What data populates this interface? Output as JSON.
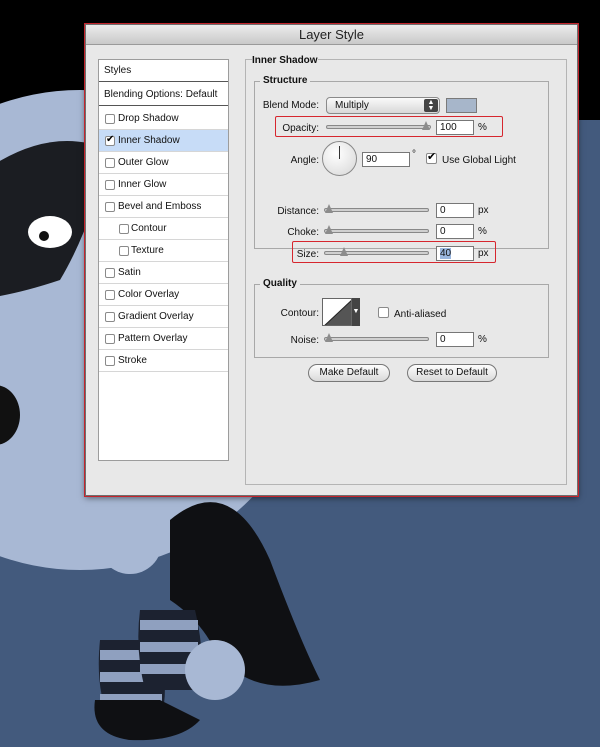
{
  "dialog": {
    "title": "Layer Style"
  },
  "styles_list": {
    "header": "Styles",
    "blending": "Blending Options: Default",
    "items": [
      {
        "label": "Drop Shadow",
        "checked": false,
        "selected": false,
        "indent": false
      },
      {
        "label": "Inner Shadow",
        "checked": true,
        "selected": true,
        "indent": false
      },
      {
        "label": "Outer Glow",
        "checked": false,
        "selected": false,
        "indent": false
      },
      {
        "label": "Inner Glow",
        "checked": false,
        "selected": false,
        "indent": false
      },
      {
        "label": "Bevel and Emboss",
        "checked": false,
        "selected": false,
        "indent": false
      },
      {
        "label": "Contour",
        "checked": false,
        "selected": false,
        "indent": true
      },
      {
        "label": "Texture",
        "checked": false,
        "selected": false,
        "indent": true
      },
      {
        "label": "Satin",
        "checked": false,
        "selected": false,
        "indent": false
      },
      {
        "label": "Color Overlay",
        "checked": false,
        "selected": false,
        "indent": false
      },
      {
        "label": "Gradient Overlay",
        "checked": false,
        "selected": false,
        "indent": false
      },
      {
        "label": "Pattern Overlay",
        "checked": false,
        "selected": false,
        "indent": false
      },
      {
        "label": "Stroke",
        "checked": false,
        "selected": false,
        "indent": false
      }
    ]
  },
  "inner_shadow": {
    "title": "Inner Shadow",
    "structure": {
      "title": "Structure",
      "blend_mode_label": "Blend Mode:",
      "blend_mode_value": "Multiply",
      "shadow_color": "#a7b6ca",
      "opacity_label": "Opacity:",
      "opacity_value": "100",
      "opacity_unit": "%",
      "opacity_level": 1.0,
      "angle_label": "Angle:",
      "angle_value": "90",
      "angle_unit": "°",
      "global_light_label": "Use Global Light",
      "global_light_checked": true,
      "distance_label": "Distance:",
      "distance_value": "0",
      "distance_unit": "px",
      "distance_level": 0.0,
      "choke_label": "Choke:",
      "choke_value": "0",
      "choke_unit": "%",
      "choke_level": 0.0,
      "size_label": "Size:",
      "size_value": "40",
      "size_unit": "px",
      "size_level": 0.16
    },
    "quality": {
      "title": "Quality",
      "contour_label": "Contour:",
      "anti_aliased_label": "Anti-aliased",
      "anti_aliased_checked": false,
      "noise_label": "Noise:",
      "noise_value": "0",
      "noise_unit": "%",
      "noise_level": 0.0
    },
    "buttons": {
      "make_default": "Make Default",
      "reset_default": "Reset to Default"
    }
  },
  "colors": {
    "background": "#435a7d",
    "highlight_red": "#d6262e",
    "selection": "#c7dcf7"
  }
}
